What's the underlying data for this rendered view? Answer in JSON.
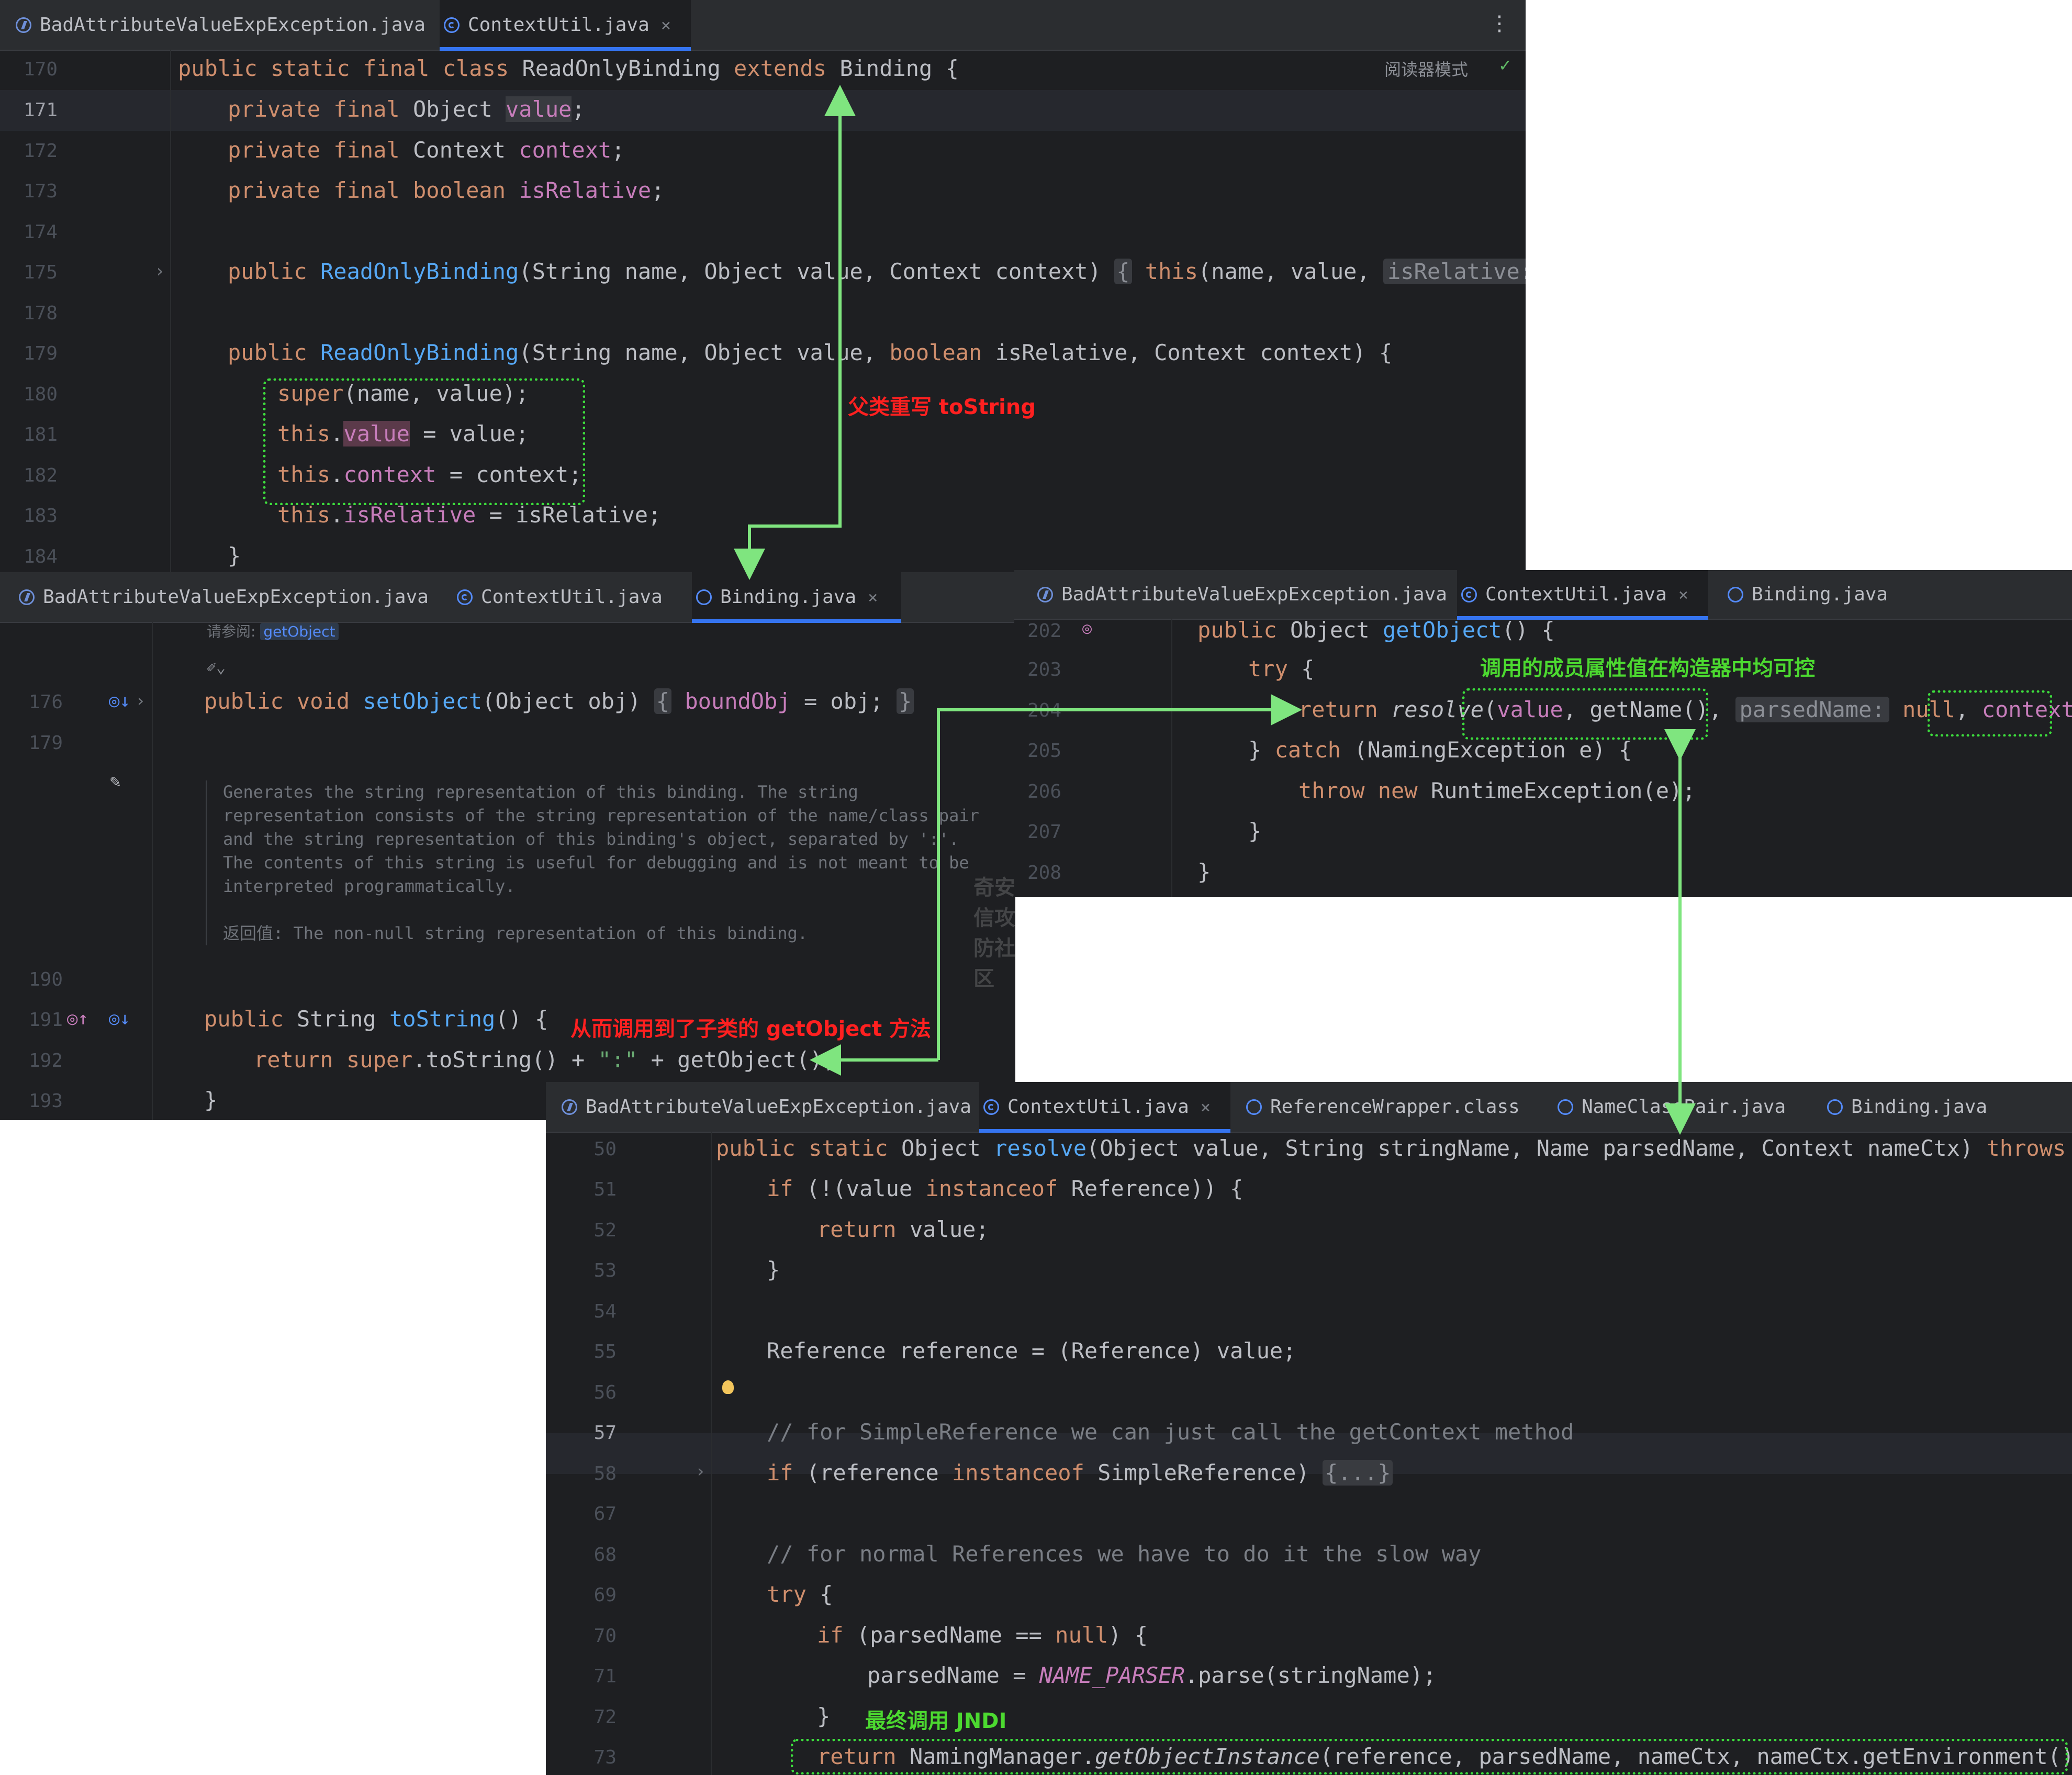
{
  "panel1": {
    "tabs": [
      "BadAttributeValueExpException.java",
      "ContextUtil.java"
    ],
    "close": "×",
    "more": "⋮",
    "reader_mode": "阅读器模式",
    "check": "✓",
    "lines": [
      "170",
      "171",
      "172",
      "173",
      "174",
      "175",
      "178",
      "179",
      "180",
      "181",
      "182",
      "183",
      "184"
    ]
  },
  "panel2": {
    "tabs": [
      "BadAttributeValueExpException.java",
      "ContextUtil.java",
      "Binding.java"
    ],
    "close": "×",
    "see_also": "请参阅:",
    "see_also_link": "getObject",
    "lines": [
      "176",
      "179",
      "190",
      "191",
      "192",
      "193"
    ],
    "doc": [
      "Generates the string representation of this binding. The string",
      "representation consists of the string representation of the name/class pair",
      "and the string representation of this binding's object, separated by ':'.",
      "The contents of this string is useful for debugging and is not meant to be",
      "interpreted programmatically."
    ],
    "doc_return": "返回值: The non-null string representation of this binding.",
    "watermark": "奇安信攻防社区"
  },
  "panel3": {
    "tabs": [
      "BadAttributeValueExpException.java",
      "ContextUtil.java",
      "Binding.java"
    ],
    "close": "×",
    "lines": [
      "202",
      "203",
      "204",
      "205",
      "206",
      "207",
      "208"
    ]
  },
  "panel4": {
    "tabs": [
      "BadAttributeValueExpException.java",
      "ContextUtil.java",
      "ReferenceWrapper.class",
      "NameClassPair.java",
      "Binding.java"
    ],
    "close": "×",
    "lines": [
      "50",
      "51",
      "52",
      "53",
      "54",
      "55",
      "56",
      "57",
      "58",
      "67",
      "68",
      "69",
      "70",
      "71",
      "72",
      "73"
    ]
  },
  "annotations": {
    "parent_override": "父类重写 toString",
    "calls_subclass": "从而调用到了子类的 getObject 方法",
    "controllable": "调用的成员属性值在构造器中均可控",
    "final_jndi": "最终调用 JNDI"
  },
  "colors": {
    "editor_bg": "#1e1f22",
    "keyword": "#cf8e6d",
    "function": "#56a8f5",
    "field": "#c77dbb",
    "annotation_red": "#ff2020",
    "annotation_green": "#4cd930",
    "arrow": "#7fe57f"
  }
}
